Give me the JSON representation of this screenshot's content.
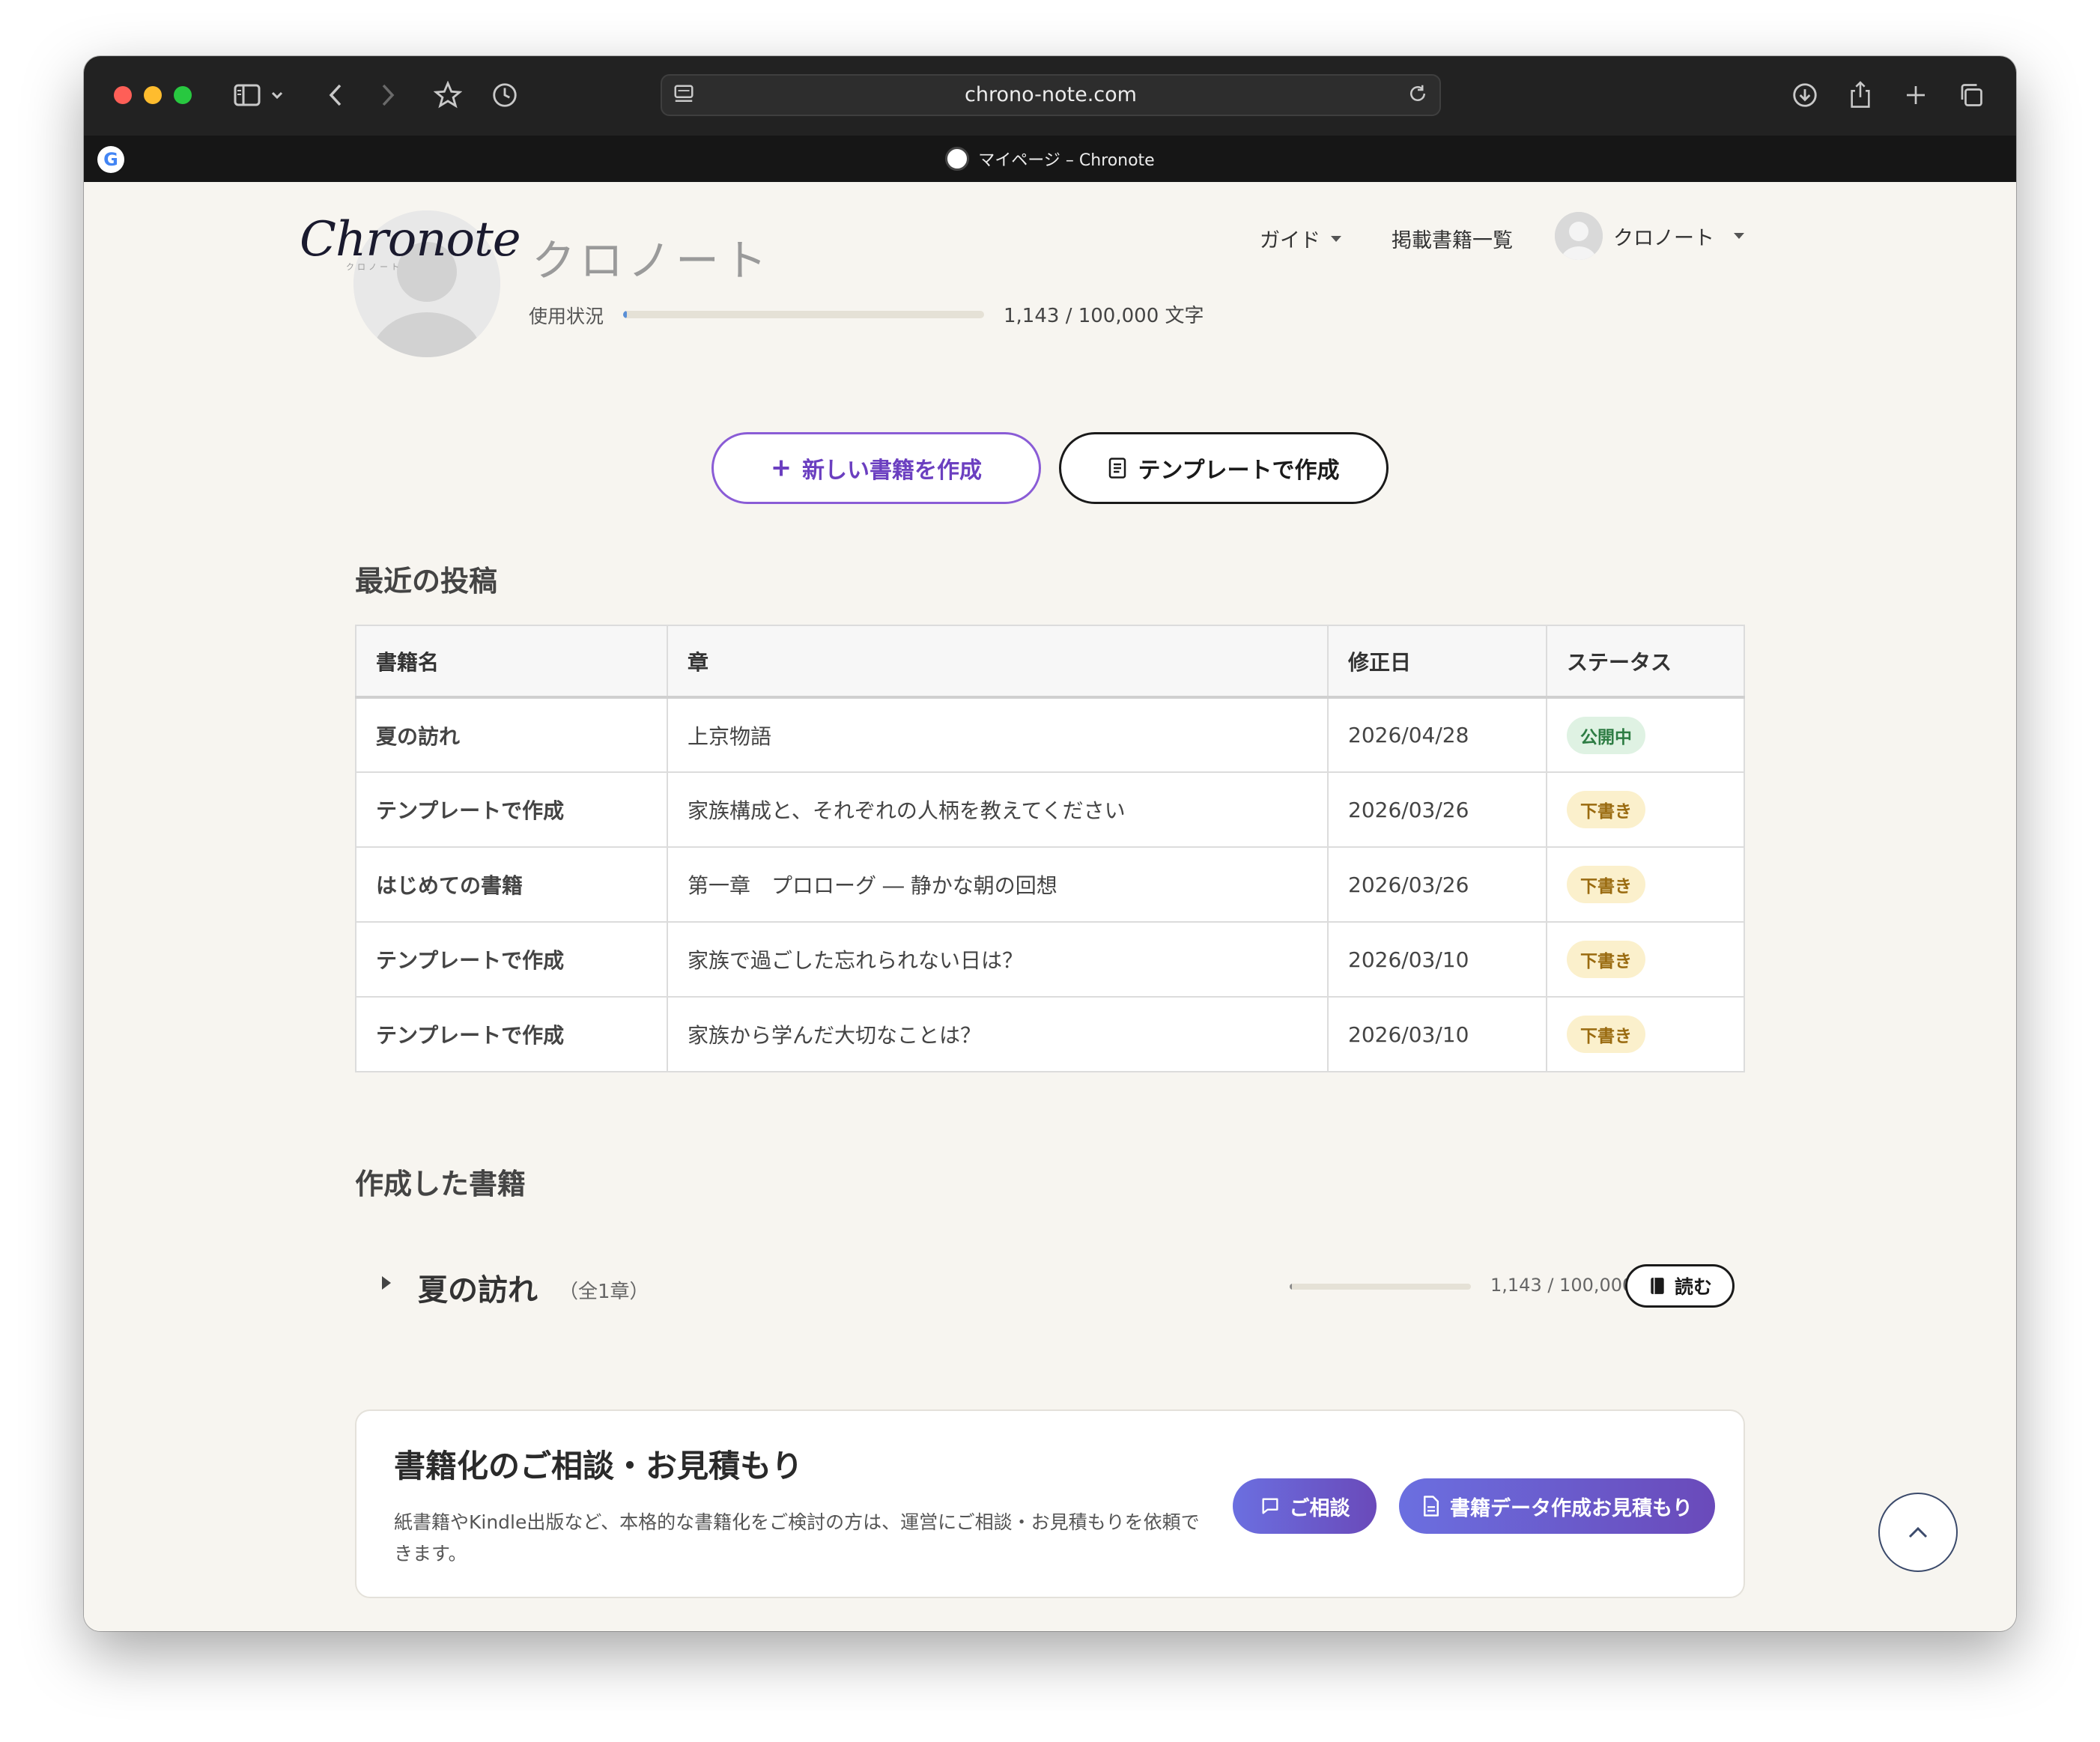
{
  "browser": {
    "url": "chrono-note.com",
    "tab_title": "マイページ – Chronote",
    "favicon_letter": "G"
  },
  "header": {
    "logo": "Chronote",
    "logo_sub": "クロノート",
    "nav": {
      "guide": "ガイド",
      "books_list": "掲載書籍一覧",
      "user": "クロノート"
    }
  },
  "profile": {
    "name": "クロノート",
    "usage_label": "使用状況",
    "usage_text": "1,143 / 100,000 文字",
    "usage_fraction": 0.011
  },
  "actions": {
    "new_book": "新しい書籍を作成",
    "template": "テンプレートで作成"
  },
  "recent": {
    "title": "最近の投稿",
    "columns": [
      "書籍名",
      "章",
      "修正日",
      "ステータス"
    ],
    "rows": [
      {
        "book": "夏の訪れ",
        "chapter": "上京物語",
        "date": "2026/04/28",
        "status": "公開中",
        "status_type": "published"
      },
      {
        "book": "テンプレートで作成",
        "chapter": "家族構成と、それぞれの人柄を教えてください",
        "date": "2026/03/26",
        "status": "下書き",
        "status_type": "draft"
      },
      {
        "book": "はじめての書籍",
        "chapter": "第一章　プロローグ ― 静かな朝の回想",
        "date": "2026/03/26",
        "status": "下書き",
        "status_type": "draft"
      },
      {
        "book": "テンプレートで作成",
        "chapter": "家族で過ごした忘れられない日は？",
        "date": "2026/03/10",
        "status": "下書き",
        "status_type": "draft"
      },
      {
        "book": "テンプレートで作成",
        "chapter": "家族から学んだ大切なことは？",
        "date": "2026/03/10",
        "status": "下書き",
        "status_type": "draft"
      }
    ]
  },
  "books": {
    "title": "作成した書籍",
    "items": [
      {
        "name": "夏の訪れ",
        "count": "（全1章）",
        "words": "1,143 / 100,000",
        "fraction": 0.011,
        "read_label": "読む"
      }
    ]
  },
  "consult": {
    "title": "書籍化のご相談・お見積もり",
    "desc": "紙書籍やKindle出版など、本格的な書籍化をご検討の方は、運営にご相談・お見積もりを依頼できます。",
    "consult_label": "ご相談",
    "estimate_label": "書籍データ作成お見積もり"
  },
  "colors": {
    "accent": "#6b3fc0",
    "published_bg": "#dff2e3",
    "draft_bg": "#fbf0cc",
    "page_bg": "#f7f5f0"
  }
}
